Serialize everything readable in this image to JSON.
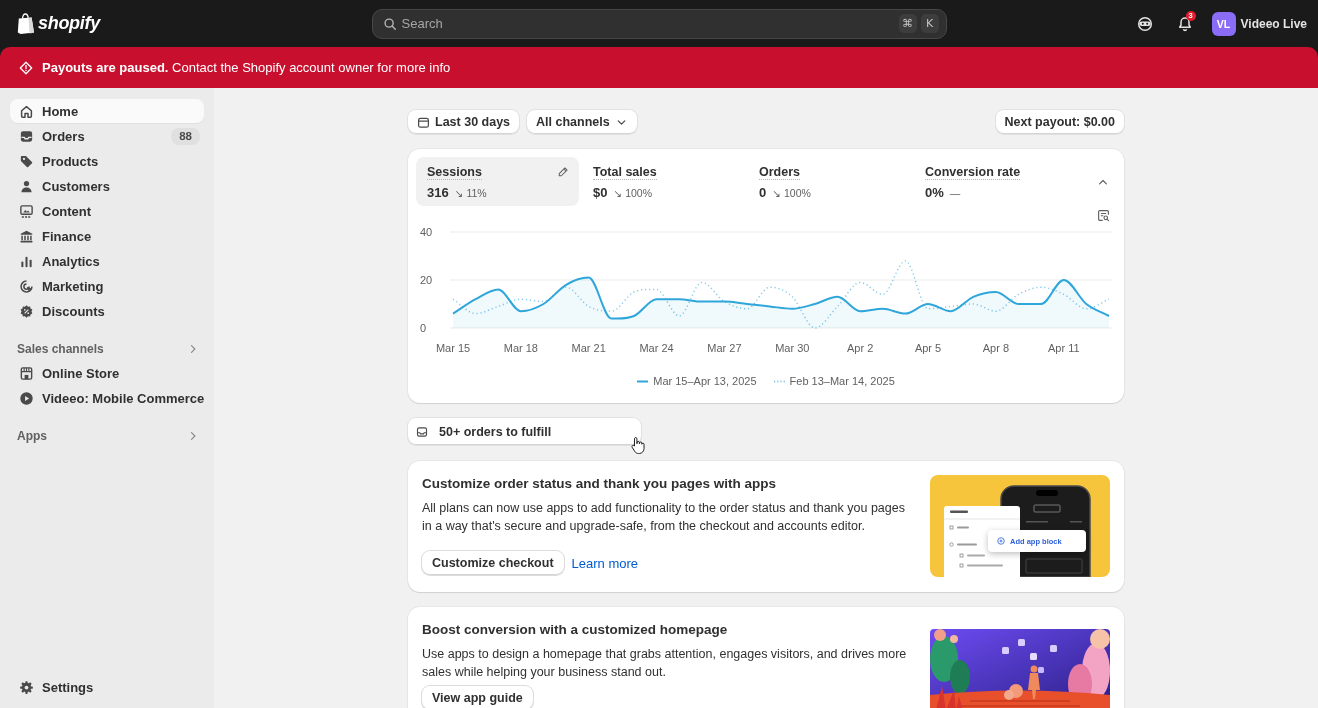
{
  "top_bar": {
    "logo": "shopify",
    "search": {
      "placeholder": "Search",
      "keys": [
        "⌘",
        "K"
      ]
    },
    "notification_count": "3",
    "account": {
      "initials": "VL",
      "name": "Videeo Live"
    }
  },
  "banner": {
    "message": "**Payouts are paused.** Contact the Shopify account owner for more info"
  },
  "sidebar": {
    "items": [
      {
        "label": "Home",
        "selected": true
      },
      {
        "label": "Orders",
        "badge": "88",
        "selected": false
      },
      {
        "label": "Products",
        "selected": false
      },
      {
        "label": "Customers",
        "selected": false
      },
      {
        "label": "Content",
        "selected": false
      },
      {
        "label": "Finance",
        "selected": false
      },
      {
        "label": "Analytics",
        "selected": false
      },
      {
        "label": "Marketing",
        "selected": false
      },
      {
        "label": "Discounts",
        "selected": false
      }
    ],
    "sections": [
      {
        "title": "Sales channels",
        "items": [
          {
            "label": "Online Store",
            "selected": false
          },
          {
            "label": "Videeo: Mobile Commerce",
            "selected": false
          }
        ]
      },
      {
        "title": "Apps"
      }
    ],
    "settings": {
      "label": "Settings",
      "selected": false
    }
  },
  "toolbar": {
    "filters": [
      {
        "kind": "date",
        "label": "Last 30 days"
      },
      {
        "kind": "dropdown",
        "label": "All channels"
      }
    ],
    "payout": "Next payout: $0.00"
  },
  "analytics_card": {
    "expanded": true,
    "metrics": [
      {
        "label": "Sessions",
        "value": "316",
        "change": "↘ 11%",
        "selected": true
      },
      {
        "label": "Total sales",
        "value": "$0",
        "change": "↘ 100%",
        "selected": false
      },
      {
        "label": "Orders",
        "value": "0",
        "change": "↘ 100%",
        "selected": false
      },
      {
        "label": "Conversion rate",
        "value": "0%",
        "change": "—",
        "selected": false
      }
    ],
    "chart_data": {
      "type": "line",
      "legend": "bottom",
      "categories": [
        "Mar 15",
        null,
        null,
        "Mar 18",
        null,
        null,
        "Mar 21",
        null,
        null,
        "Mar 24",
        null,
        null,
        "Mar 27",
        null,
        null,
        "Mar 30",
        null,
        null,
        "Apr 2",
        null,
        null,
        "Apr 5",
        null,
        null,
        "Apr 8",
        null,
        null,
        "Apr 11",
        null,
        null
      ],
      "ylim": [
        0,
        40
      ],
      "yticks": [
        0,
        20,
        40
      ],
      "series": [
        {
          "name": "Mar 15–Apr 13, 2025",
          "color": "#2fa6da",
          "line_style": "solid",
          "values": [
            6,
            12,
            16,
            7,
            10,
            18,
            21,
            4,
            5,
            12,
            12,
            11,
            11,
            10,
            9,
            8,
            10,
            13,
            7,
            8,
            6,
            10,
            7,
            13,
            15,
            10,
            10,
            20,
            10,
            5
          ]
        },
        {
          "name": "Feb 13–Mar 14, 2025",
          "color": "#86cbe9",
          "line_style": "dotted",
          "values": [
            12,
            6,
            9,
            12,
            11,
            17,
            9,
            7,
            15,
            16,
            5,
            19,
            11,
            8,
            17,
            13,
            0,
            9,
            19,
            14,
            28,
            8,
            9,
            10,
            7,
            14,
            17,
            14,
            8,
            12
          ]
        }
      ]
    }
  },
  "fulfill_button": {
    "label": "50+ orders to fulfill"
  },
  "cards": [
    {
      "kind": "checkout",
      "title": "Customize order status and thank you pages with apps",
      "body": "All plans can now use apps to add functionality to the order status and thank you pages in a way that's secure and upgrade-safe, from the checkout and accounts editor.",
      "button": "Customize checkout",
      "link": "Learn more",
      "illustration": {
        "popup": "Add app block"
      }
    },
    {
      "kind": "homepage",
      "title": "Boost conversion with a customized homepage",
      "body": "Use apps to design a homepage that grabs attention, engages visitors, and drives more sales while helping your business stand out.",
      "button": "View app guide"
    }
  ]
}
